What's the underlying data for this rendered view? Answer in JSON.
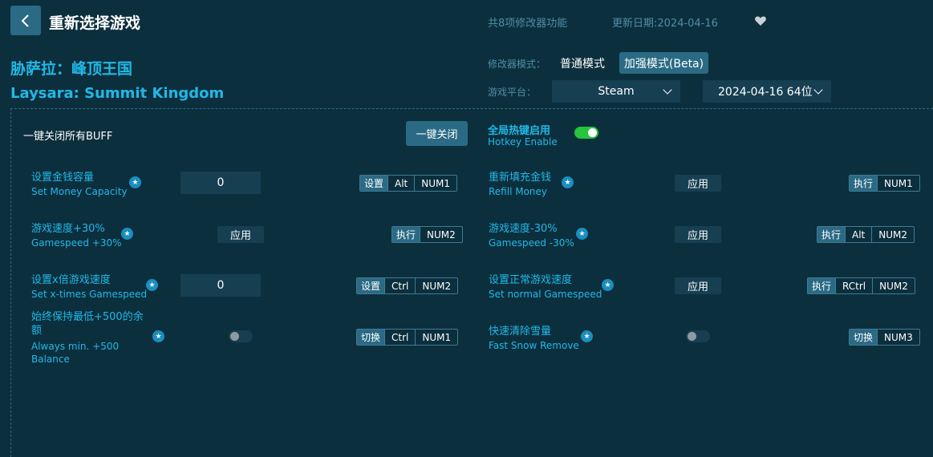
{
  "header": {
    "back_icon": "chevron-left-icon",
    "title": "重新选择游戏",
    "feature_count": "共8项修改器功能",
    "update_date": "更新日期:2024-04-16",
    "favorite_icon": "heart-icon"
  },
  "game": {
    "name_cn": "胁萨拉：峰顶王国",
    "name_en": "Laysara: Summit Kingdom"
  },
  "mode": {
    "label": "修改器模式：",
    "normal": "普通模式",
    "enhanced": "加强模式(Beta)",
    "selected": "加强模式(Beta)"
  },
  "platform": {
    "label": "游戏平台：",
    "selected": "Steam",
    "version": "2024-04-16 64位"
  },
  "global": {
    "all_off_label": "一键关闭所有BUFF",
    "all_off_button": "一键关闭",
    "hotkey_cn": "全局热键启用",
    "hotkey_en": "Hotkey Enable",
    "hotkey_enabled": true
  },
  "features": [
    {
      "cn": "设置金钱容量",
      "en": "Set Money Capacity",
      "control": "input",
      "value": "0",
      "hotkey": [
        "设置",
        "Alt",
        "NUM1"
      ]
    },
    {
      "cn": "重新填充金钱",
      "en": "Refill Money",
      "control": "apply",
      "button": "应用",
      "hotkey": [
        "执行",
        "NUM1"
      ]
    },
    {
      "cn": "游戏速度+30%",
      "en": "Gamespeed +30%",
      "control": "apply",
      "button": "应用",
      "hotkey": [
        "执行",
        "NUM2"
      ]
    },
    {
      "cn": "游戏速度-30%",
      "en": "Gamespeed -30%",
      "control": "apply",
      "button": "应用",
      "hotkey": [
        "执行",
        "Alt",
        "NUM2"
      ]
    },
    {
      "cn": "设置x倍游戏速度",
      "en": "Set x-times Gamespeed",
      "control": "input",
      "value": "0",
      "hotkey": [
        "设置",
        "Ctrl",
        "NUM2"
      ]
    },
    {
      "cn": "设置正常游戏速度",
      "en": "Set normal Gamespeed",
      "control": "apply",
      "button": "应用",
      "hotkey": [
        "执行",
        "RCtrl",
        "NUM2"
      ]
    },
    {
      "cn": "始终保持最低+500的余额",
      "en": "Always min. +500 Balance",
      "control": "toggle",
      "enabled": false,
      "hotkey": [
        "切换",
        "Ctrl",
        "NUM1"
      ]
    },
    {
      "cn": "快速清除雪量",
      "en": "Fast Snow Remove",
      "control": "toggle",
      "enabled": false,
      "hotkey": [
        "切换",
        "NUM3"
      ]
    }
  ]
}
